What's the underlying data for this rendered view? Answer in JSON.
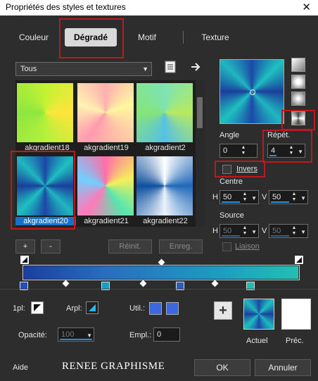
{
  "window": {
    "title": "Propriétés des styles et textures",
    "close": "✕"
  },
  "tabs": [
    {
      "label": "Couleur"
    },
    {
      "label": "Dégradé"
    },
    {
      "label": "Motif"
    },
    {
      "label": "Texture"
    }
  ],
  "library": {
    "selected": "Tous"
  },
  "gradients": [
    {
      "name": "akgradient18"
    },
    {
      "name": "akgradient19"
    },
    {
      "name": "akgradient2"
    },
    {
      "name": "akgradient20"
    },
    {
      "name": "akgradient21"
    },
    {
      "name": "akgradient22"
    }
  ],
  "list_buttons": {
    "add": "+",
    "remove": "-",
    "reset": "Réinit.",
    "save": "Enreg."
  },
  "options": {
    "angle_label": "Angle",
    "angle_value": "0",
    "repeat_label": "Répét.",
    "repeat_value": "4",
    "invert_label": "Invers",
    "center_label": "Centre",
    "center_h_label": "H",
    "center_h": "50",
    "center_v_label": "V",
    "center_v": "50",
    "source_label": "Source",
    "source_h_label": "H",
    "source_h": "50",
    "source_v_label": "V",
    "source_v": "50",
    "link_label": "Liaison"
  },
  "editor": {
    "first_label": "1pl:",
    "arpl_label": "Arpl:",
    "util_label": "Util.:",
    "opacity_label": "Opacité:",
    "opacity_value": "100",
    "empl_label": "Empl.:",
    "empl_value": "0",
    "add": "+",
    "current_label": "Actuel",
    "previous_label": "Préc."
  },
  "footer": {
    "help": "Aide",
    "brand": "RENEE GRAPHISME",
    "ok": "OK",
    "cancel": "Annuler"
  },
  "colors": {
    "accent": "#1672c8",
    "highlight": "#c0191b",
    "gradient_dark": "#1a3f9c",
    "gradient_light": "#1fc0b0"
  }
}
